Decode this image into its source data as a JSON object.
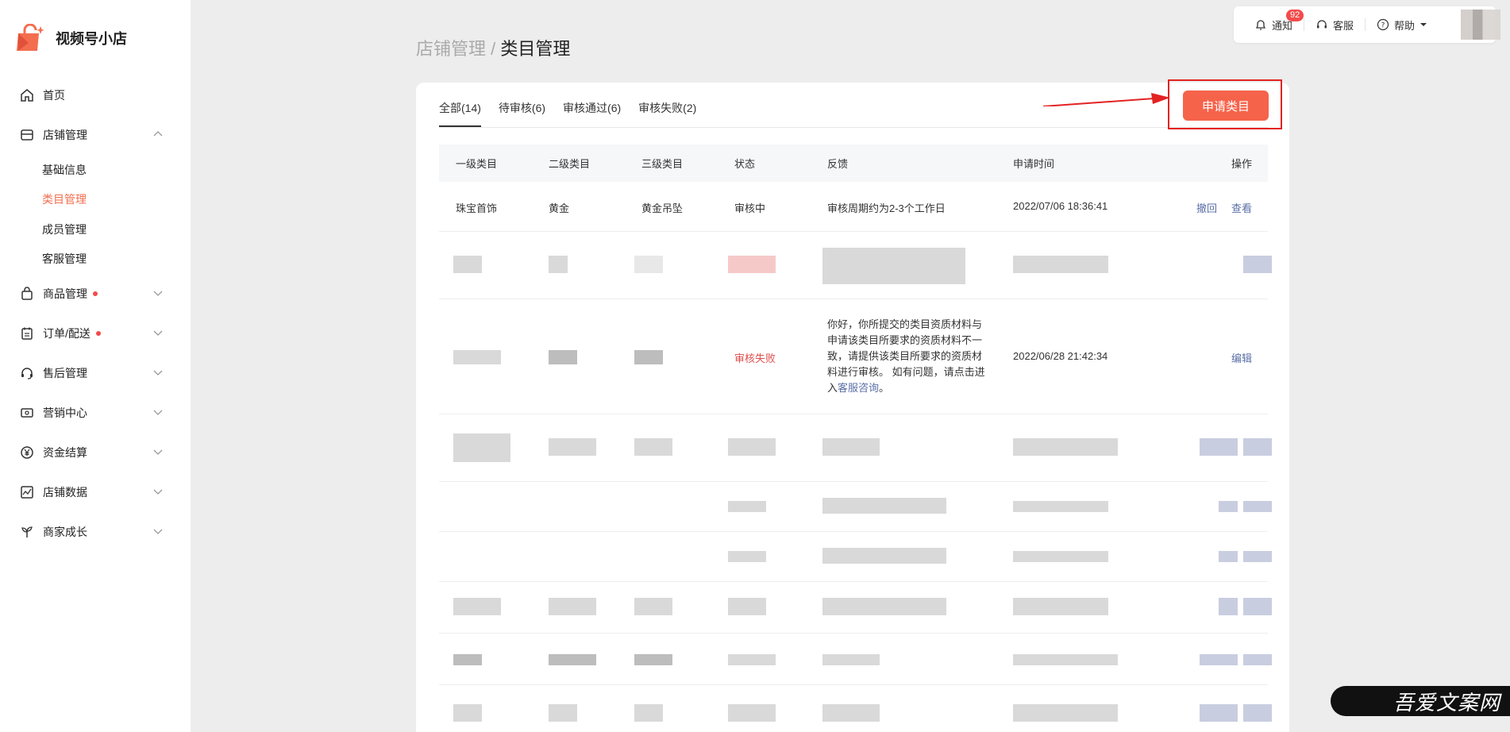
{
  "app": {
    "name": "视频号小店"
  },
  "colors": {
    "accent": "#f5634a",
    "active_text": "#f36e4f",
    "highlight_frame": "#e32222"
  },
  "sidebar": {
    "items": [
      {
        "label": "首页",
        "icon": "home-icon"
      },
      {
        "label": "店铺管理",
        "icon": "shop-icon",
        "expanded": true,
        "children": [
          "基础信息",
          "类目管理",
          "成员管理",
          "客服管理"
        ],
        "active_child": "类目管理"
      },
      {
        "label": "商品管理",
        "icon": "bag-icon",
        "dot": true
      },
      {
        "label": "订单/配送",
        "icon": "clipboard-icon",
        "dot": true
      },
      {
        "label": "售后管理",
        "icon": "headset-icon"
      },
      {
        "label": "营销中心",
        "icon": "ticket-icon"
      },
      {
        "label": "资金结算",
        "icon": "yen-icon"
      },
      {
        "label": "店铺数据",
        "icon": "chart-icon"
      },
      {
        "label": "商家成长",
        "icon": "sprout-icon"
      }
    ]
  },
  "topbar": {
    "notify_label": "通知",
    "notify_count": "92",
    "service_label": "客服",
    "help_label": "帮助"
  },
  "breadcrumb": {
    "parent": "店铺管理",
    "sep": "/",
    "current": "类目管理"
  },
  "tabs": [
    {
      "label": "全部(14)",
      "active": true
    },
    {
      "label": "待审核(6)"
    },
    {
      "label": "审核通过(6)"
    },
    {
      "label": "审核失败(2)"
    }
  ],
  "apply_button": "申请类目",
  "table": {
    "headers": [
      "一级类目",
      "二级类目",
      "三级类目",
      "状态",
      "反馈",
      "申请时间",
      "操作"
    ],
    "rows": [
      {
        "c1": "珠宝首饰",
        "c2": "黄金",
        "c3": "黄金吊坠",
        "status": "审核中",
        "feedback": "审核周期约为2-3个工作日",
        "time": "2022/07/06 18:36:41",
        "actions": [
          "撤回",
          "查看"
        ]
      },
      {
        "status": "审核失败",
        "feedback_pre": "你好，你所提交的类目资质材料与申请该类目所要求的资质材料不一致，请提供该类目所要求的资质材料进行审核。 如有问题，请点击进入",
        "feedback_link": "客服咨询",
        "feedback_post": "。",
        "time": "2022/06/28 21:42:34",
        "actions": [
          "编辑"
        ]
      }
    ]
  },
  "watermark": "吾爱文案网"
}
